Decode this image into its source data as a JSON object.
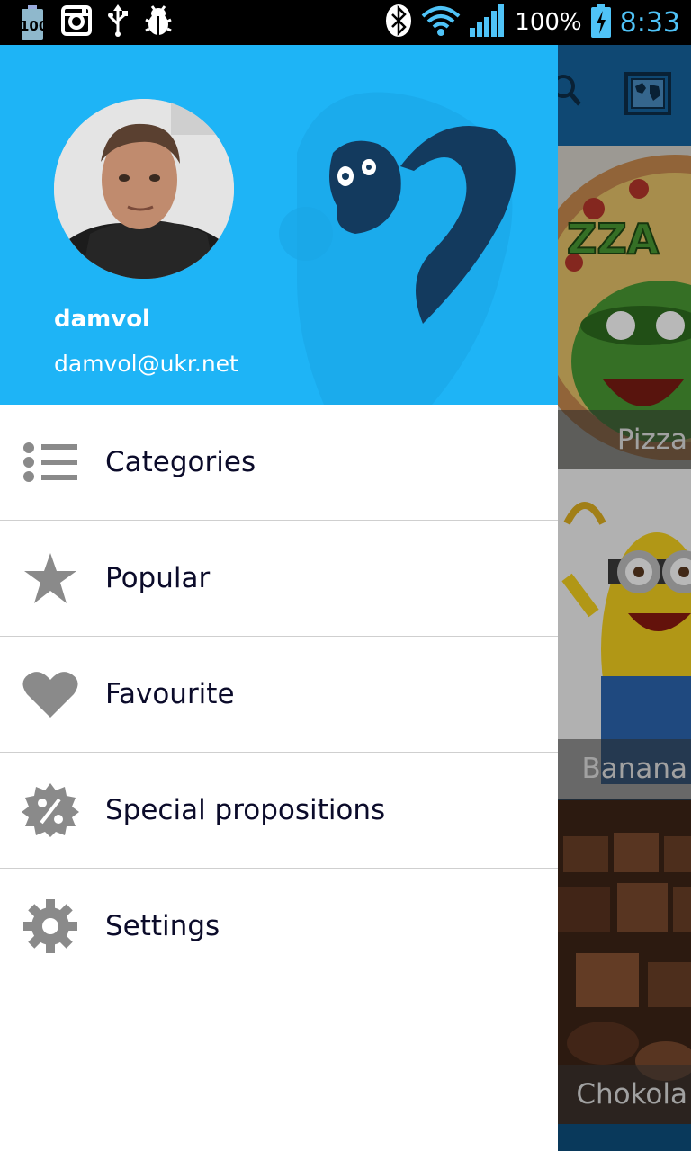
{
  "status_bar": {
    "battery_badge": "100",
    "battery_percent": "100%",
    "time": "8:33",
    "icons": [
      "battery-100-icon",
      "instagram-icon",
      "usb-icon",
      "debug-bug-icon",
      "bluetooth-icon",
      "wifi-icon",
      "signal-icon",
      "battery-charging-icon"
    ]
  },
  "drawer": {
    "header": {
      "user_name": "damvol",
      "user_email": "damvol@ukr.net",
      "brand_color": "#1eb4f6"
    },
    "menu": [
      {
        "label": "Categories",
        "icon": "list-icon"
      },
      {
        "label": "Popular",
        "icon": "star-icon"
      },
      {
        "label": "Favourite",
        "icon": "heart-icon"
      },
      {
        "label": "Special propositions",
        "icon": "discount-percent-icon"
      },
      {
        "label": "Settings",
        "icon": "gear-icon"
      }
    ]
  },
  "background_app": {
    "toolbar_icons": [
      "search-icon",
      "map-icon"
    ],
    "cards": [
      {
        "caption": "Pizza"
      },
      {
        "caption": "Banana"
      },
      {
        "caption": "Chokola"
      }
    ]
  }
}
